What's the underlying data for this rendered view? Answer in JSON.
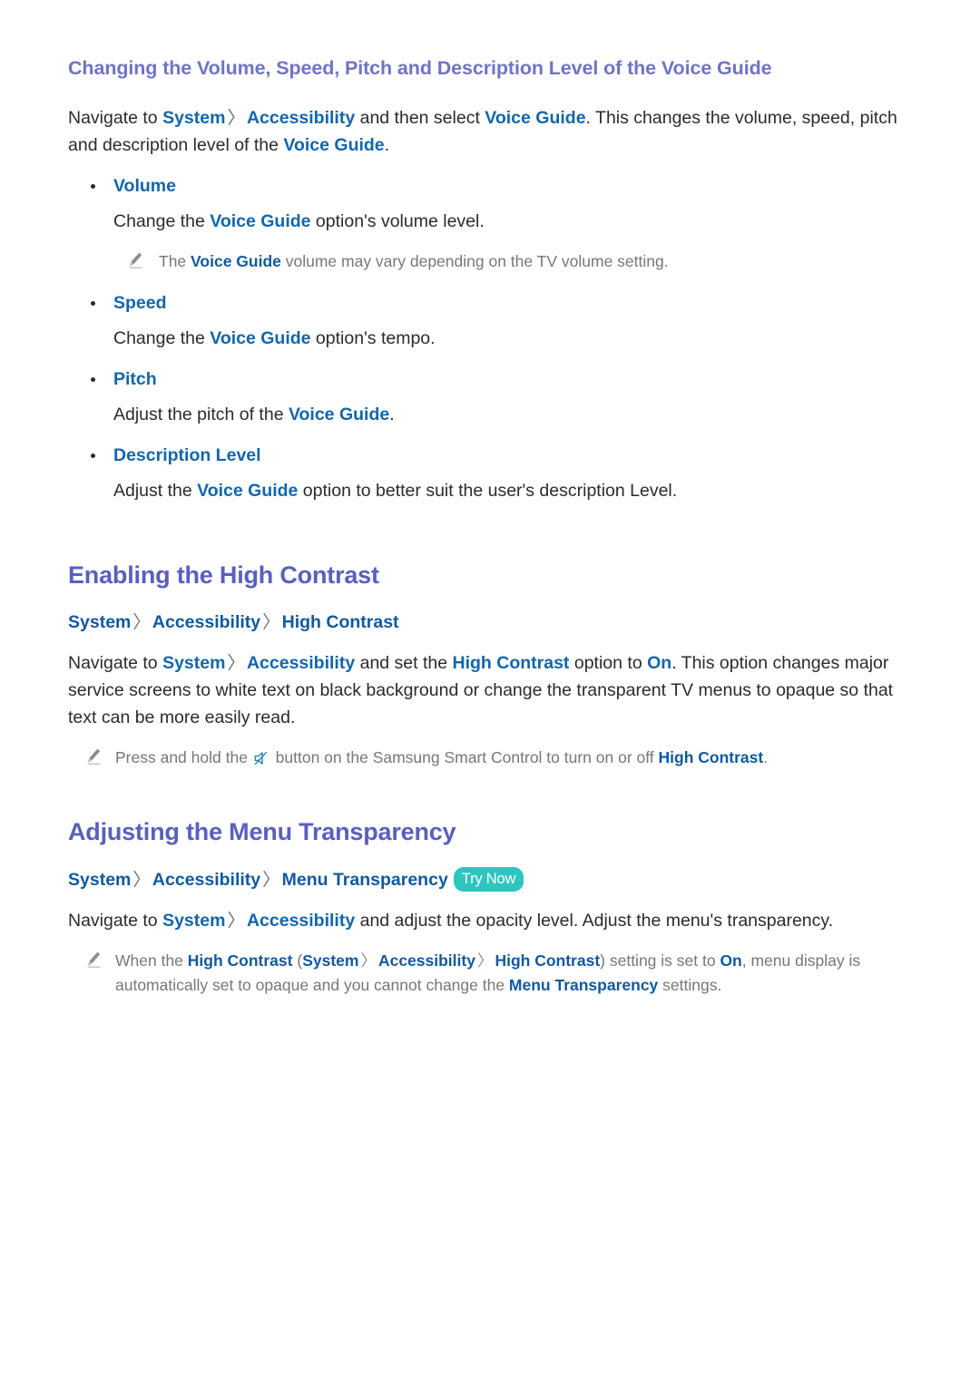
{
  "document": {
    "sections": [
      {
        "id": "voice-guide",
        "heading": "Changing the Volume, Speed, Pitch and Description Level of the Voice Guide",
        "intro": {
          "p1": "Navigate to ",
          "link1": "System",
          "sep1": "〉",
          "link2": "Accessibility",
          "p2": " and then select ",
          "link3": "Voice Guide",
          "p3": ". This changes the volume, speed, pitch and description level of the ",
          "link4": "Voice Guide",
          "p4": "."
        },
        "bullets": [
          {
            "label": "Volume",
            "desc_pre": "Change the ",
            "desc_link": "Voice Guide",
            "desc_post": " option's volume level.",
            "note": {
              "pre": "The ",
              "link": "Voice Guide",
              "post": " volume may vary depending on the TV volume setting."
            }
          },
          {
            "label": "Speed",
            "desc_pre": "Change the ",
            "desc_link": "Voice Guide",
            "desc_post": " option's tempo."
          },
          {
            "label": "Pitch",
            "desc_pre": "Adjust the pitch of the ",
            "desc_link": "Voice Guide",
            "desc_post": "."
          },
          {
            "label": "Description Level",
            "desc_pre": "Adjust the ",
            "desc_link": "Voice Guide",
            "desc_post": " option to better suit the user's description Level."
          }
        ]
      },
      {
        "id": "high-contrast",
        "heading": "Enabling the High Contrast",
        "path": {
          "item1": "System",
          "sep1": "〉",
          "item2": "Accessibility",
          "sep2": "〉",
          "item3": "High Contrast"
        },
        "body": {
          "p1": "Navigate to ",
          "link1": "System",
          "sep1": "〉",
          "link2": "Accessibility",
          "p2": " and set the ",
          "link3": "High Contrast",
          "p3": " option to ",
          "link4": "On",
          "p4": ". This option changes major service screens to white text on black background or change the transparent TV menus to opaque so that text can be more easily read."
        },
        "note": {
          "pre": "Press and hold the ",
          "icon": "mute-button-icon",
          "mid": " button on the Samsung Smart Control to turn on or off ",
          "link": "High Contrast",
          "post": "."
        }
      },
      {
        "id": "menu-transparency",
        "heading": "Adjusting the Menu Transparency",
        "path": {
          "item1": "System",
          "sep1": "〉",
          "item2": "Accessibility",
          "sep2": "〉",
          "item3": "Menu Transparency",
          "badge": "Try Now"
        },
        "body": {
          "p1": "Navigate to ",
          "link1": "System",
          "sep1": "〉",
          "link2": "Accessibility",
          "p2": " and adjust the opacity level. Adjust the menu's transparency."
        },
        "note": {
          "pre": "When the ",
          "link1": "High Contrast",
          "paren_open": " (",
          "link2": "System",
          "sep1": "〉",
          "link3": "Accessibility",
          "sep2": "〉",
          "link4": "High Contrast",
          "paren_close": ")",
          "mid": " setting is set to ",
          "link5": "On",
          "post": ", menu display is automatically set to opaque and you cannot change the ",
          "link6": "Menu Transparency",
          "tail": " settings."
        }
      }
    ]
  },
  "icons": {
    "note": "pencil-icon",
    "mute": "mute-button-icon"
  },
  "colors": {
    "heading_main": "#5a5fbe",
    "heading_sub": "#6f74c4",
    "link": "#1266ab",
    "path": "#11599f",
    "badge_bg": "#2ec4bf",
    "note_text": "#777777",
    "body_text": "#2b2b2b"
  }
}
